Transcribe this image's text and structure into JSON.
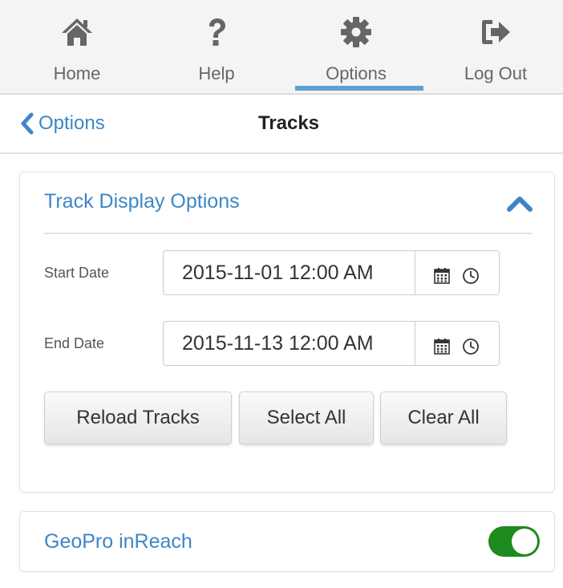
{
  "nav": {
    "items": [
      {
        "label": "Home",
        "icon": "home-icon"
      },
      {
        "label": "Help",
        "icon": "question-icon"
      },
      {
        "label": "Options",
        "icon": "gear-icon"
      },
      {
        "label": "Log Out",
        "icon": "logout-icon"
      }
    ],
    "active": "Options"
  },
  "subheader": {
    "back_label": "Options",
    "title": "Tracks"
  },
  "track_panel": {
    "title": "Track Display Options",
    "start_label": "Start Date",
    "start_value": "2015-11-01 12:00 AM",
    "end_label": "End Date",
    "end_value": "2015-11-13 12:00 AM",
    "buttons": {
      "reload": "Reload Tracks",
      "select_all": "Select All",
      "clear_all": "Clear All"
    }
  },
  "device_panel": {
    "title": "GeoPro inReach",
    "toggle_on": true
  },
  "colors": {
    "accent": "#3d86c6",
    "active_underline": "#5aa0d6",
    "toggle_on": "#1c8a1c",
    "nav_icon": "#666666"
  }
}
